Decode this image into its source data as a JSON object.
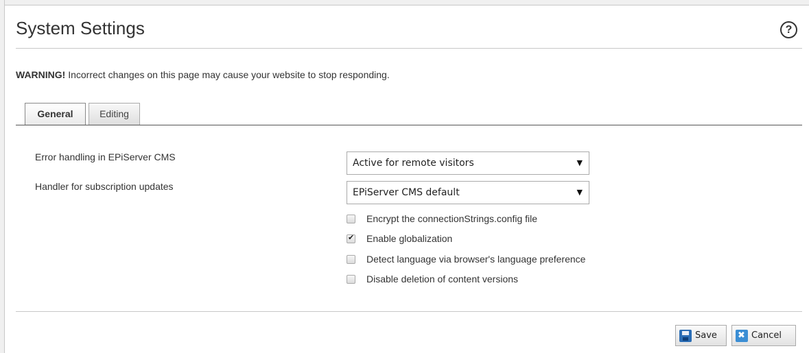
{
  "page": {
    "title": "System Settings",
    "help_symbol": "?"
  },
  "warning": {
    "strong": "WARNING!",
    "text": " Incorrect changes on this page may cause your website to stop responding."
  },
  "tabs": [
    {
      "label": "General",
      "active": true
    },
    {
      "label": "Editing",
      "active": false
    }
  ],
  "fields": {
    "error_handling": {
      "label": "Error handling in EPiServer CMS",
      "value": "Active for remote visitors"
    },
    "subscription_handler": {
      "label": "Handler for subscription updates",
      "value": "EPiServer CMS default"
    }
  },
  "options": [
    {
      "label": "Encrypt the connectionStrings.config file",
      "checked": false
    },
    {
      "label": "Enable globalization",
      "checked": true
    },
    {
      "label": "Detect language via browser's language preference",
      "checked": false
    },
    {
      "label": "Disable deletion of content versions",
      "checked": false
    }
  ],
  "actions": {
    "save_label": "Save",
    "cancel_label": "Cancel"
  },
  "icons": {
    "help": "help-icon",
    "dropdown": "chevron-down-icon",
    "save": "floppy-disk-icon",
    "cancel": "cancel-icon"
  },
  "colors": {
    "save_icon": "#2a6db5",
    "cancel_icon": "#3b8ed4",
    "text": "#333333"
  }
}
